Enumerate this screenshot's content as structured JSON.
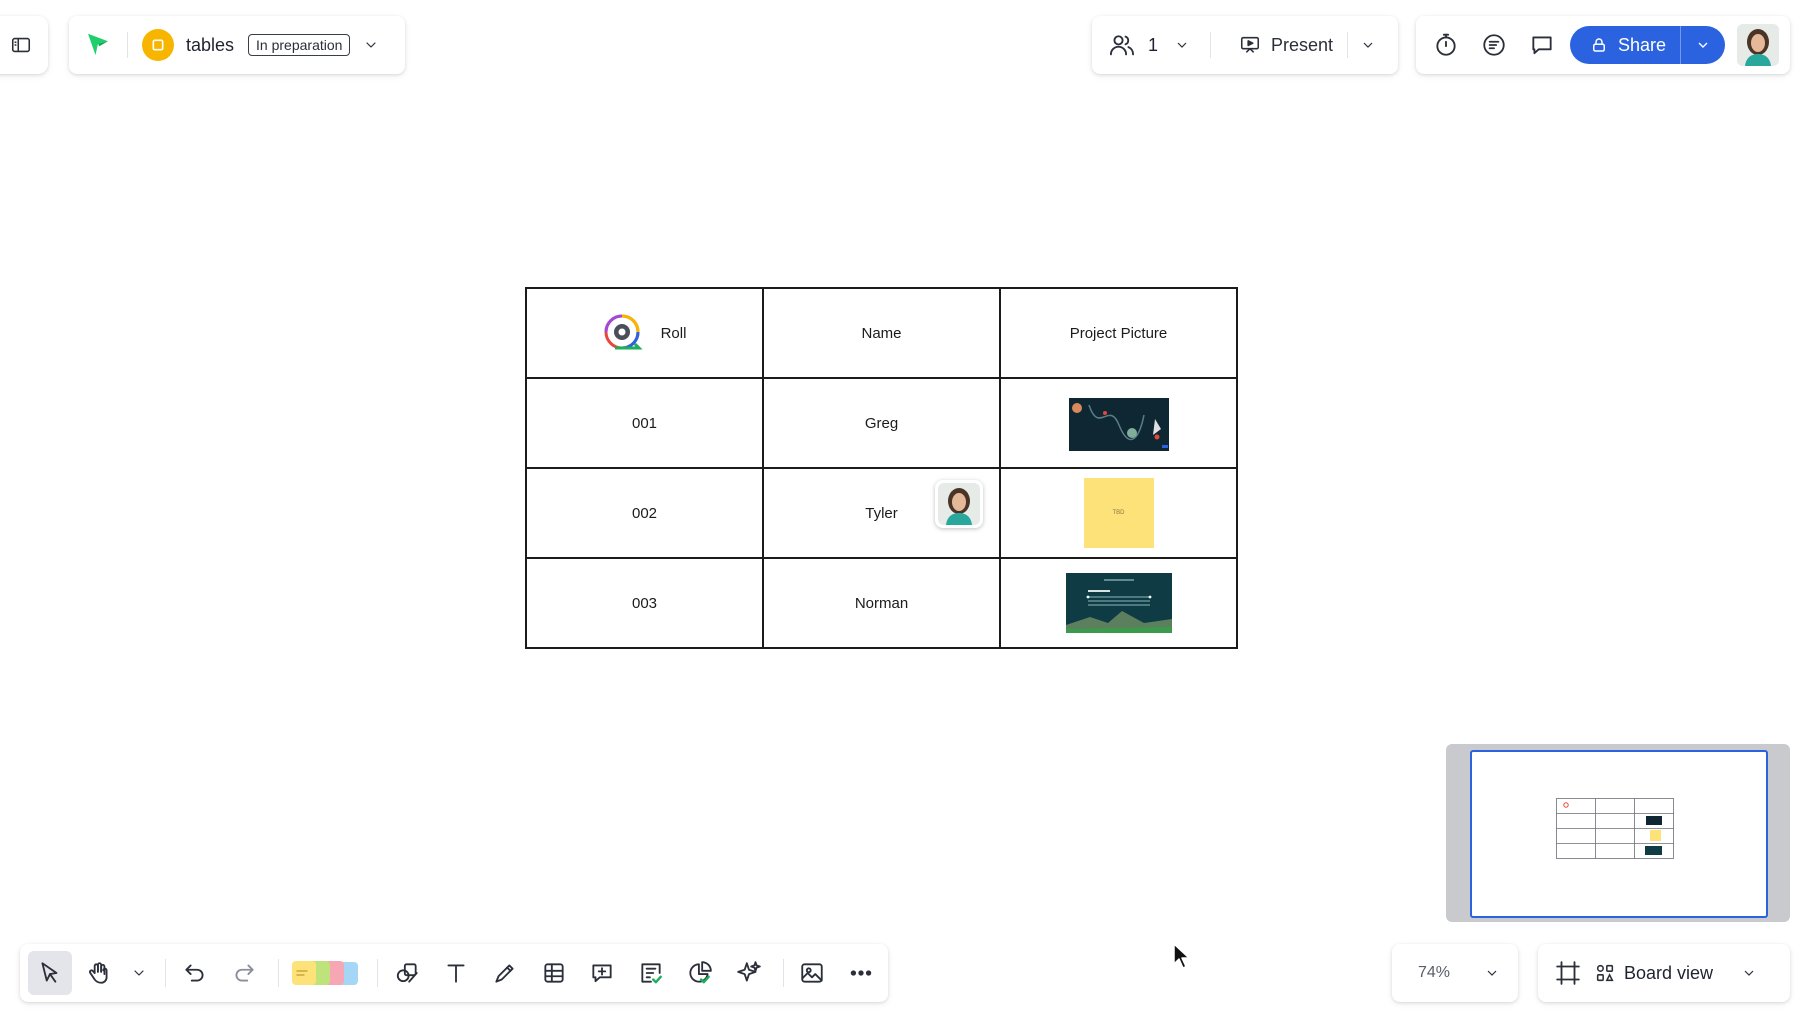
{
  "header": {
    "board_name": "tables",
    "status": "In preparation"
  },
  "collab": {
    "user_count": "1",
    "present_label": "Present"
  },
  "share": {
    "label": "Share"
  },
  "table": {
    "rows": [
      [
        "Roll",
        "Name",
        "Project Picture"
      ],
      [
        "001",
        "Greg",
        ""
      ],
      [
        "002",
        "Tyler",
        ""
      ],
      [
        "003",
        "Norman",
        ""
      ]
    ]
  },
  "sticky_text": "TBD",
  "zoom": {
    "level": "74%"
  },
  "view": {
    "label": "Board view"
  },
  "colors": {
    "accent": "#2a62e0",
    "sticky": "#fde27a",
    "board_icon": "#f7b500",
    "brand": "#1fcf6b"
  },
  "icons": {
    "sidebar": "sidebar-toggle-icon",
    "brand": "paper-plane-icon",
    "users": "users-icon",
    "present": "present-icon",
    "timer": "timer-icon",
    "notes": "notes-icon",
    "comments": "comments-icon",
    "lock": "lock-icon"
  }
}
